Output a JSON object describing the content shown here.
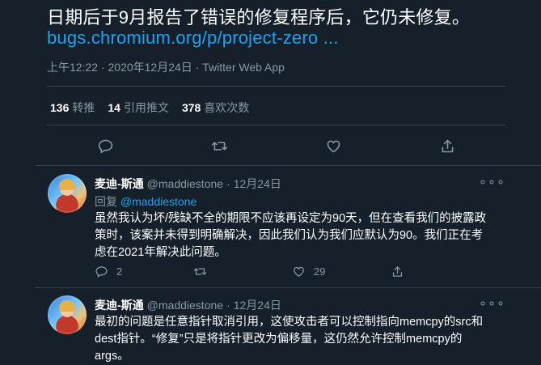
{
  "main_tweet": {
    "text_line": "日期后于9月报告了错误的修复程序后，它仍未修复。",
    "link": "bugs.chromium.org/p/project-zero ...",
    "time": "上午12:22",
    "sep1": "·",
    "date": "2020年12月24日",
    "sep2": "·",
    "client": "Twitter Web App",
    "stats": {
      "retweets_count": "136",
      "retweets_label": "转推",
      "quotes_count": "14",
      "quotes_label": "引用推文",
      "likes_count": "378",
      "likes_label": "喜欢次数"
    }
  },
  "replies": [
    {
      "name": "麦迪-斯通",
      "handle": "@maddiestone",
      "dot": "·",
      "date": "12月24日",
      "replying_prefix": "回复",
      "replying_to": "@maddiestone",
      "lines": [
        "虽然我认为坏/残缺不全的期限不应该再设定为90天，但在查看我们的披露政",
        "策时，该案并未得到明确解决，因此我们认为我们应默认为90。我们正在考",
        "虑在2021年解决此问题。"
      ],
      "reply_count": "2",
      "retweet_count": "",
      "like_count": "29"
    },
    {
      "name": "麦迪-斯通",
      "handle": "@maddiestone",
      "dot": "·",
      "date": "12月24日",
      "lines": [
        "最初的问题是任意指针取消引用，这使攻击者可以控制指向memcpy的src和",
        "dest指针。“修复”只是将指针更改为偏移量，这仍然允许控制memcpy的",
        "args。"
      ]
    }
  ],
  "more_glyph": "∘∘∘",
  "icons": [
    "reply-icon",
    "retweet-icon",
    "like-icon",
    "share-icon",
    "more-icon"
  ],
  "colors": {
    "background": "#15202b",
    "link": "#1da1f2",
    "muted": "#8899a6",
    "divider": "#38444d"
  }
}
